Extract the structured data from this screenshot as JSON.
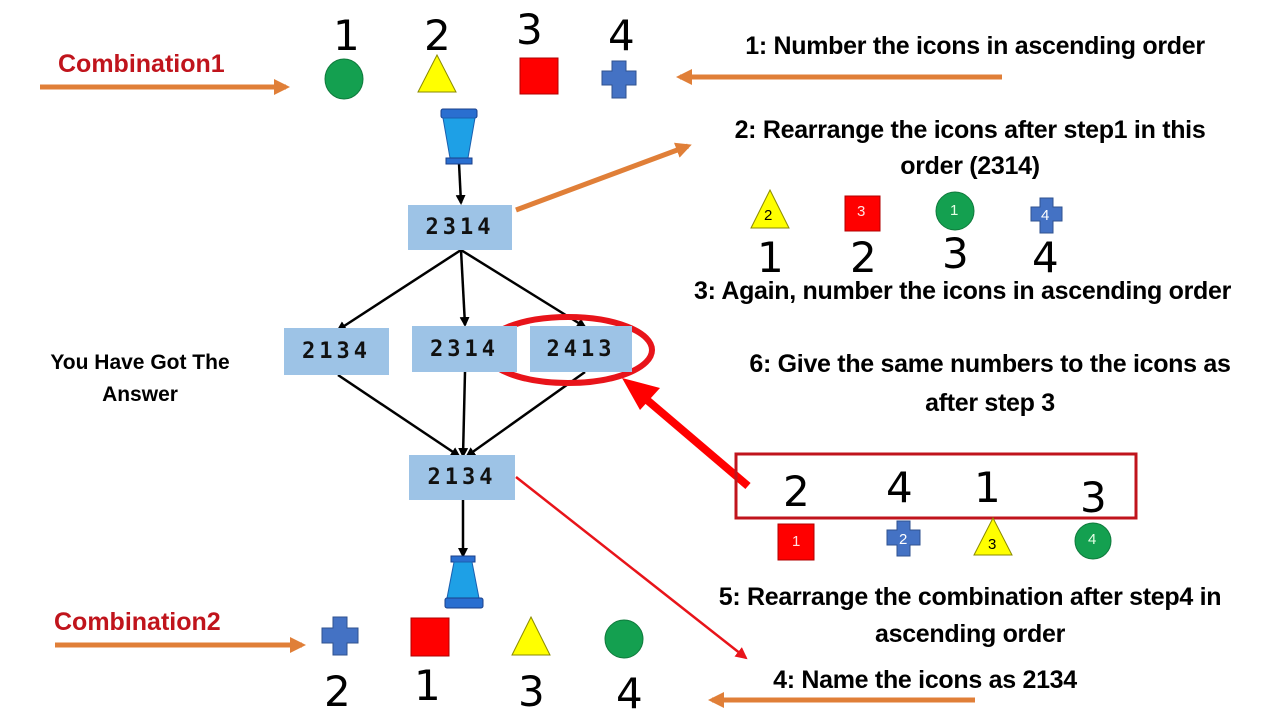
{
  "title_labels": {
    "combination1": "Combination1",
    "combination2": "Combination2",
    "answer": "You Have Got The Answer"
  },
  "steps": {
    "step1": "1: Number the icons in ascending order",
    "step2_line1": "2: Rearrange the icons after step1 in this",
    "step2_line2": "order (2314)",
    "step3": "3: Again, number the icons in ascending order",
    "step4": "4: Name the icons as 2134",
    "step5_line1": "5: Rearrange the combination after step4 in",
    "step5_line2": "ascending order",
    "step6_line1": "6: Give the same numbers to the icons as",
    "step6_line2": "after step 3"
  },
  "combination1": {
    "numbers": [
      "1",
      "2",
      "3",
      "4"
    ],
    "icons": [
      "green-circle",
      "yellow-triangle",
      "red-square",
      "blue-cross"
    ]
  },
  "step2_row": {
    "icons": [
      {
        "shape": "yellow-triangle",
        "label": "2"
      },
      {
        "shape": "red-square",
        "label": "3"
      },
      {
        "shape": "green-circle",
        "label": "1"
      },
      {
        "shape": "blue-cross",
        "label": "4"
      }
    ],
    "numbers": [
      "1",
      "2",
      "3",
      "4"
    ]
  },
  "flow_boxes": {
    "top": "2314",
    "middle_left": "2134",
    "middle_center": "2314",
    "middle_right": "2413",
    "bottom": "2134"
  },
  "step6_box": {
    "numbers": [
      "2",
      "4",
      "1",
      "3"
    ],
    "icons": [
      {
        "shape": "red-square",
        "label": "1"
      },
      {
        "shape": "blue-cross",
        "label": "2"
      },
      {
        "shape": "yellow-triangle",
        "label": "3"
      },
      {
        "shape": "green-circle",
        "label": "4"
      }
    ]
  },
  "combination2": {
    "numbers": [
      "2",
      "1",
      "3",
      "4"
    ],
    "icons": [
      "blue-cross",
      "red-square",
      "yellow-triangle",
      "green-circle"
    ]
  },
  "colors": {
    "orange_arrow": "#e07f38",
    "red_accent": "#e8141a",
    "dark_red": "#c0141c",
    "box_fill": "#9dc3e6",
    "green": "#14a050",
    "yellow": "#ffff00",
    "red": "#ff0000",
    "blue": "#4472c4",
    "funnel_blue": "#1ea0e6"
  }
}
